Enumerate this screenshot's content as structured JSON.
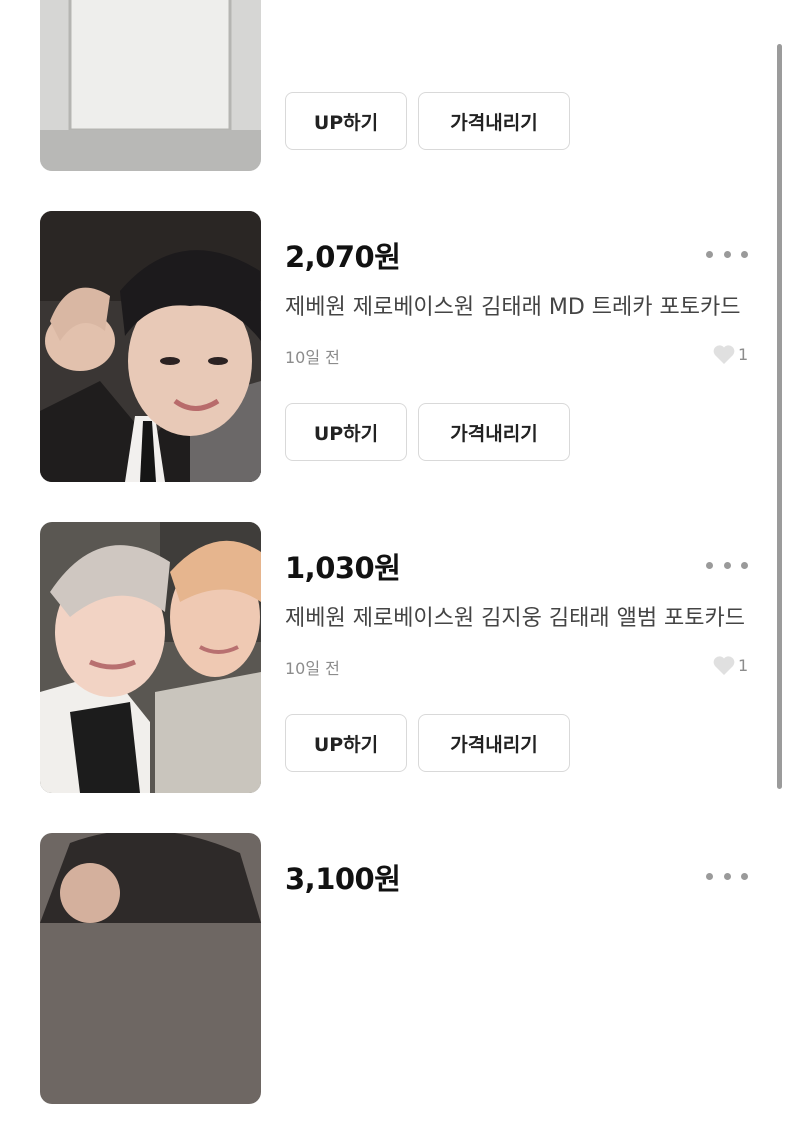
{
  "buttons": {
    "up_label": "UP하기",
    "price_down_label": "가격내리기"
  },
  "items": [
    {
      "price": "",
      "title": "",
      "time": "",
      "likes": "",
      "thumb_desc": "photocard"
    },
    {
      "price": "2,070원",
      "title": "제베원 제로베이스원 김태래 MD 트레카 포토카드",
      "time": "10일 전",
      "likes": "1",
      "thumb_desc": "photocard"
    },
    {
      "price": "1,030원",
      "title": "제베원 제로베이스원 김지웅 김태래 앨범 포토카드",
      "time": "10일 전",
      "likes": "1",
      "thumb_desc": "photocard"
    },
    {
      "price": "3,100원",
      "title": "",
      "time": "",
      "likes": "",
      "thumb_desc": "photocard"
    }
  ],
  "icons": {
    "more": "more-dots-icon",
    "like": "heart-icon"
  },
  "colors": {
    "text_primary": "#111111",
    "text_secondary": "#444444",
    "text_muted": "#8c8c8c",
    "border": "#d9d9d9",
    "heart": "#e0e0e0",
    "scrollbar": "#9b9b9b"
  }
}
